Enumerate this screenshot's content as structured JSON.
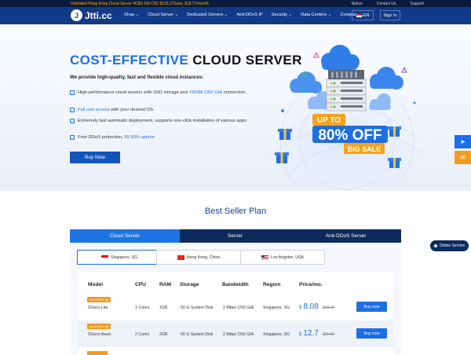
{
  "topbar": {
    "promo": "Unlimited Hong Kong Cloud Server 4C8G 5M CN2 $225.27/year, $18.77/month",
    "links": [
      "Notice",
      "Contact Us",
      "Support"
    ]
  },
  "nav": {
    "logo_text": "Jtti.cc",
    "menu": [
      "Shop",
      "Cloud Server",
      "Dedicated Servers",
      "Anti-DDoS IP",
      "Security",
      "Data Centers",
      "Company"
    ],
    "lang": "EN",
    "signin": "Sign In"
  },
  "hero": {
    "title_accent": "COST-EFFECTIVE",
    "title_rest": "CLOUD SERVER",
    "subtitle": "We provide high-quality, fast and flexible cloud instances:",
    "features": [
      {
        "pre": "High-performance cloud servers with SSD storage and ",
        "hl": "1000M CN2 GIA",
        "post": " connection."
      },
      {
        "pre": "",
        "hl": "Full root access",
        "post": " with your desired OS"
      },
      {
        "pre": "Extremely fast automatic deployment, supports one-click installation of various apps",
        "hl": "",
        "post": ""
      },
      {
        "pre": "Free DDoS protection, ",
        "hl": "99.99% uptime",
        "post": ""
      }
    ],
    "buy_label": "Buy Now",
    "promo_up_to": "UP TO",
    "promo_off": "80% OFF",
    "promo_sale": "BIG SALE"
  },
  "section": {
    "title": "Best Seller Plan",
    "tabs": [
      "Cloud Server",
      "Server",
      "Anti-DDoS Server"
    ],
    "locations": [
      "Singapore, SG",
      "Hong Kong, China",
      "Los Angeles, USA"
    ]
  },
  "table": {
    "headers": [
      "Model",
      "CPU",
      "RAM",
      "Storage",
      "Bandwidth",
      "Region",
      "Price/mo."
    ],
    "rows": [
      {
        "badge": "Up to 50% off",
        "model": "SGecs Lite",
        "cpu": "1 Cores",
        "ram": "1GB",
        "storage": "50 G System Disk",
        "bandwidth": "2 Mbps CN2 GIA",
        "region": "Singapore, SG",
        "currency": "$",
        "price": "8.08",
        "old_price": "$16.16",
        "buy": "Buy now"
      },
      {
        "badge": "Up to 50% off",
        "model": "SGecs Basic",
        "cpu": "2 Cores",
        "ram": "2GB",
        "storage": "50 G System Disk",
        "bandwidth": "2 Mbps CN2 GIA",
        "region": "Singapore, SG",
        "currency": "$",
        "price": "12.7",
        "old_price": "$25.39",
        "buy": "Buy now"
      }
    ]
  },
  "widgets": {
    "online_service": "Online Service"
  },
  "colors": {
    "nav_bg": "#123a86",
    "accent": "#1d6ee6",
    "badge": "#f39a21",
    "tab_dark": "#0d2a5c"
  }
}
